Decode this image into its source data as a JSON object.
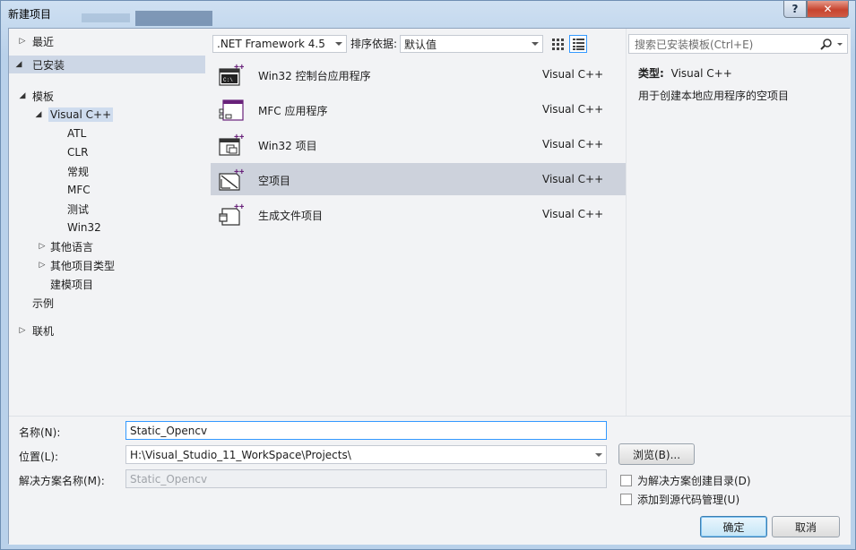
{
  "window": {
    "title": "新建项目",
    "help_label": "?",
    "close_label": "✕"
  },
  "tree": {
    "recent": "最近",
    "installed": "已安装",
    "templates": "模板",
    "visual_cpp": "Visual C++",
    "children": [
      "ATL",
      "CLR",
      "常规",
      "MFC",
      "测试",
      "Win32"
    ],
    "other_languages": "其他语言",
    "other_project_types": "其他项目类型",
    "modeling_projects": "建模项目",
    "samples": "示例",
    "online": "联机"
  },
  "toolbar": {
    "framework": ".NET Framework 4.5",
    "sort_label": "排序依据:",
    "sort_value": "默认值"
  },
  "templates": [
    {
      "name": "Win32 控制台应用程序",
      "lang": "Visual C++",
      "icon": "console-app-icon"
    },
    {
      "name": "MFC 应用程序",
      "lang": "Visual C++",
      "icon": "mfc-app-icon"
    },
    {
      "name": "Win32 项目",
      "lang": "Visual C++",
      "icon": "win32-project-icon"
    },
    {
      "name": "空项目",
      "lang": "Visual C++",
      "icon": "empty-project-icon"
    },
    {
      "name": "生成文件项目",
      "lang": "Visual C++",
      "icon": "makefile-project-icon"
    }
  ],
  "details": {
    "search_placeholder": "搜索已安装模板(Ctrl+E)",
    "type_label": "类型:",
    "type_value": "Visual C++",
    "description": "用于创建本地应用程序的空项目"
  },
  "form": {
    "name_label": "名称(N):",
    "name_value": "Static_Opencv",
    "location_label": "位置(L):",
    "location_value": "H:\\Visual_Studio_11_WorkSpace\\Projects\\",
    "solution_label": "解决方案名称(M):",
    "solution_value": "Static_Opencv",
    "browse_label": "浏览(B)...",
    "create_dir_label": "为解决方案创建目录(D)",
    "add_scc_label": "添加到源代码管理(U)",
    "ok_label": "确定",
    "cancel_label": "取消"
  },
  "colors": {
    "selection": "#cdd2dc",
    "accent": "#3399ff",
    "vc_purple": "#68217a"
  }
}
